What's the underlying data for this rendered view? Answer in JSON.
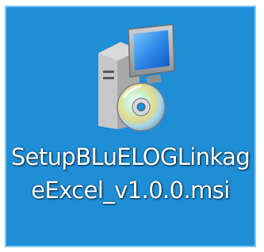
{
  "desktop": {
    "selection_color": "#1e8ed6",
    "selection_border_color": "#7ec8f3",
    "file": {
      "name": "SetupBLuELOGLinkageExcel_v1.0.0.msi",
      "icon": "msi-installer-icon",
      "selected": true
    }
  }
}
